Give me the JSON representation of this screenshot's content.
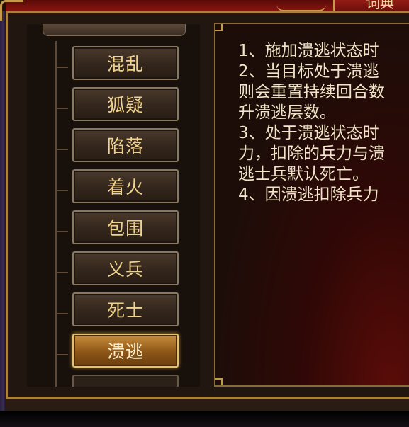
{
  "header": {
    "tab_label": "词典"
  },
  "sidebar": {
    "items": [
      {
        "label": "混乱",
        "active": false
      },
      {
        "label": "狐疑",
        "active": false
      },
      {
        "label": "陷落",
        "active": false
      },
      {
        "label": "着火",
        "active": false
      },
      {
        "label": "包围",
        "active": false
      },
      {
        "label": "义兵",
        "active": false
      },
      {
        "label": "死士",
        "active": false
      },
      {
        "label": "溃逃",
        "active": true
      }
    ]
  },
  "content": {
    "lines": [
      "1、施加溃逃状态时",
      "2、当目标处于溃逃",
      "则会重置持续回合数",
      "升溃逃层数。",
      "3、处于溃逃状态时",
      "力，扣除的兵力与溃",
      "逃士兵默认死亡。",
      "4、因溃逃扣除兵力"
    ]
  },
  "colors": {
    "active_button": "#a86a22",
    "button_text": "#f0d28c",
    "content_text": "#f2e4c8",
    "frame_gold": "#a9803c"
  }
}
